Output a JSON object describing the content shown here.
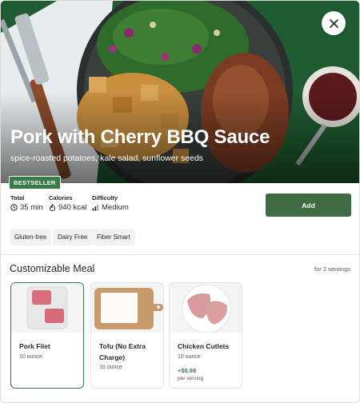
{
  "hero": {
    "title": "Pork with Cherry BBQ Sauce",
    "subtitle": "spice-roasted potatoes, kale salad, sunflower seeds",
    "badge": "BESTSELLER"
  },
  "meta": {
    "total_label": "Total",
    "total_value": "35 min",
    "calories_label": "Calories",
    "calories_value": "940 kcal",
    "difficulty_label": "Difficulty",
    "difficulty_value": "Medium"
  },
  "actions": {
    "add_label": "Add"
  },
  "tags": [
    "Gluten-free",
    "Dairy Free",
    "Fiber Smart"
  ],
  "section": {
    "title": "Customizable Meal",
    "servings": "for 2 servings"
  },
  "meals": [
    {
      "name": "Pork Filet",
      "qty": "10 ounce",
      "selected": true
    },
    {
      "name": "Tofu (No Extra Charge)",
      "qty": "10 ounce",
      "selected": false
    },
    {
      "name": "Chicken Cutlets",
      "qty": "10 ounce",
      "price": "+$0.99",
      "per": "per serving",
      "selected": false
    }
  ],
  "colors": {
    "accent": "#3a7a47",
    "hero_bg": "#1d5a2f",
    "add_button": "#3f6b43"
  },
  "icons": [
    "close-icon",
    "clock-icon",
    "flame-icon",
    "difficulty-bars-icon"
  ]
}
